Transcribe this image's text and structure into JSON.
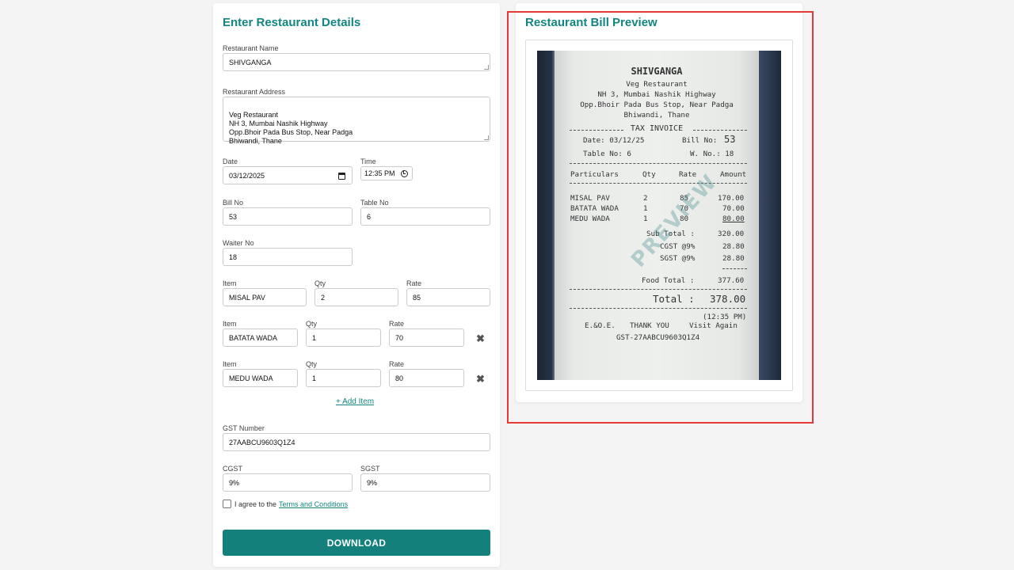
{
  "form": {
    "title": "Enter Restaurant Details",
    "restaurant_name_label": "Restaurant Name",
    "restaurant_name": "SHIVGANGA",
    "address_label": "Restaurant Address",
    "address": "Veg Restaurant\nNH 3, Mumbai Nashik Highway\nOpp.Bhoir Pada Bus Stop, Near Padga\nBhiwandi, Thane",
    "date_label": "Date",
    "date": "03/12/2025",
    "time_label": "Time",
    "time": "12:35 PM",
    "bill_no_label": "Bill No",
    "bill_no": "53",
    "table_no_label": "Table No",
    "table_no": "6",
    "waiter_no_label": "Waiter No",
    "waiter_no": "18",
    "item_label": "Item",
    "qty_label": "Qty",
    "rate_label": "Rate",
    "items": [
      {
        "item": "MISAL PAV",
        "qty": "2",
        "rate": "85"
      },
      {
        "item": "BATATA WADA",
        "qty": "1",
        "rate": "70"
      },
      {
        "item": "MEDU WADA",
        "qty": "1",
        "rate": "80"
      }
    ],
    "remove_glyph": "✖",
    "add_item": "+ Add Item",
    "gst_label": "GST Number",
    "gst": "27AABCU9603Q1Z4",
    "cgst_label": "CGST",
    "cgst": "9%",
    "sgst_label": "SGST",
    "sgst": "9%",
    "agree_text": "I agree to the",
    "terms_link": "Terms and Conditions",
    "download": "DOWNLOAD"
  },
  "preview": {
    "title": "Restaurant Bill Preview",
    "watermark": "PREVIEW",
    "receipt": {
      "name": "SHIVGANGA",
      "addr1": "Veg Restaurant",
      "addr2": "NH 3, Mumbai Nashik Highway",
      "addr3": "Opp.Bhoir Pada Bus Stop, Near Padga",
      "addr4": "Bhiwandi, Thane",
      "tax_invoice": "TAX INVOICE",
      "date_text": "Date: 03/12/25",
      "bill_label": "Bill No:",
      "bill_no": "53",
      "table_text": "Table No: 6",
      "waiter_text": "W. No.: 18",
      "col_particulars": "Particulars",
      "col_qty": "Qty",
      "col_rate": "Rate",
      "col_amount": "Amount",
      "rows": [
        {
          "name": "MISAL PAV",
          "qty": "2",
          "rate": "85",
          "amount": "170.00"
        },
        {
          "name": "BATATA WADA",
          "qty": "1",
          "rate": "70",
          "amount": "70.00"
        },
        {
          "name": "MEDU WADA",
          "qty": "1",
          "rate": "80",
          "amount": "80.00"
        }
      ],
      "subtotal_label": "Sub Total :",
      "subtotal": "320.00",
      "cgst_label": "CGST @9%",
      "cgst": "28.80",
      "sgst_label": "SGST @9%",
      "sgst": "28.80",
      "food_total_label": "Food Total :",
      "food_total": "377.60",
      "total_label": "Total :",
      "total": "378.00",
      "time_text": "(12:35 PM)",
      "eoe": "E.&O.E.",
      "thanks": "THANK YOU",
      "visit": "Visit Again",
      "gst_text": "GST-27AABCU9603Q1Z4"
    }
  },
  "colors": {
    "accent": "#138580",
    "button": "#13807c",
    "highlight": "#e53935"
  }
}
